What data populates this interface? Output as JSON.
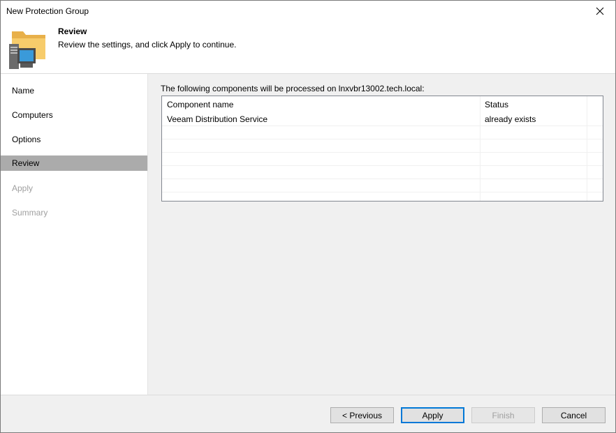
{
  "window": {
    "title": "New Protection Group",
    "close_glyph": "✕"
  },
  "header": {
    "icon": "protection-group-icon",
    "title": "Review",
    "subtitle": "Review the settings, and click Apply to continue."
  },
  "sidebar": {
    "steps": [
      {
        "label": "Name",
        "state": "normal"
      },
      {
        "label": "Computers",
        "state": "normal"
      },
      {
        "label": "Options",
        "state": "normal"
      },
      {
        "label": "Review",
        "state": "active"
      },
      {
        "label": "Apply",
        "state": "disabled"
      },
      {
        "label": "Summary",
        "state": "disabled"
      }
    ]
  },
  "content": {
    "label": "The following components will be processed on lnxvbr13002.tech.local:",
    "table": {
      "columns": [
        "Component name",
        "Status"
      ],
      "rows": [
        [
          "Veeam Distribution Service",
          "already exists"
        ]
      ]
    }
  },
  "footer": {
    "previous_label": "< Previous",
    "apply_label": "Apply",
    "finish_label": "Finish",
    "cancel_label": "Cancel"
  },
  "colors": {
    "accent": "#0078d7",
    "active_step": "#ababab"
  }
}
